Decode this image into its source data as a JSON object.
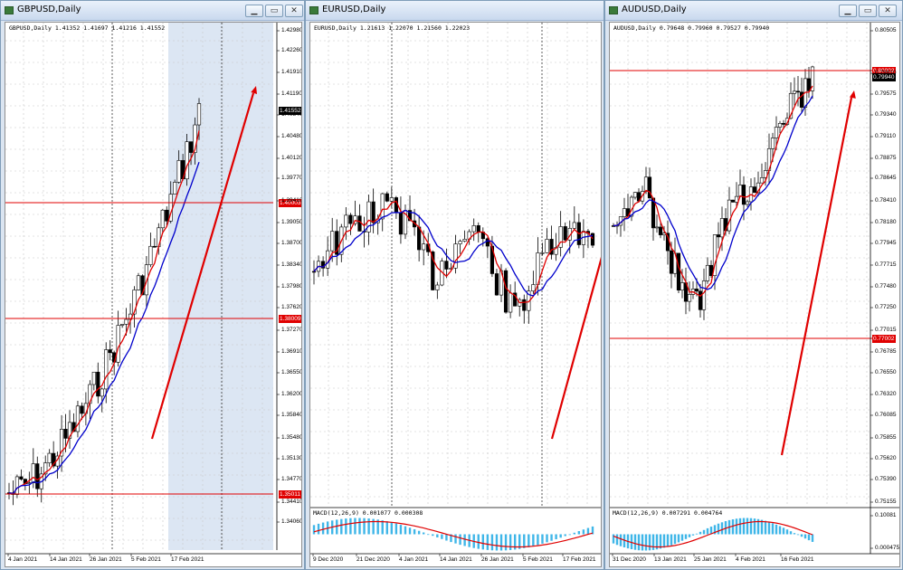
{
  "windows": [
    {
      "title": "GBPUSD,Daily",
      "header": "GBPUSD,Daily  1.41352 1.41697 1.41216 1.41552",
      "price_labels": [
        "1.42980",
        "1.42260",
        "1.41910",
        "1.41190",
        "1.40840",
        "1.40480",
        "1.40120",
        "1.39770",
        "1.39410",
        "1.39050",
        "1.38700",
        "1.38340",
        "1.37980",
        "1.37620",
        "1.37270",
        "1.36910",
        "1.36550",
        "1.36200",
        "1.35840",
        "1.35480",
        "1.35130",
        "1.34770",
        "1.34410",
        "1.34060"
      ],
      "current_price": "1.41552",
      "levels": [
        {
          "label": "1.40003"
        },
        {
          "label": "1.38009"
        },
        {
          "label": "1.35011"
        }
      ],
      "date_labels": [
        "4 Jan 2021",
        "14 Jan 2021",
        "26 Jan 2021",
        "5 Feb 2021",
        "17 Feb 2021"
      ],
      "macd_label": ""
    },
    {
      "title": "EURUSD,Daily",
      "header": "EURUSD,Daily  1.21613 1.22070 1.21560 1.22023",
      "price_labels": [],
      "current_price": "",
      "levels": [],
      "date_labels": [
        "9 Dec 2020",
        "21 Dec 2020",
        "4 Jan 2021",
        "14 Jan 2021",
        "26 Jan 2021",
        "5 Feb 2021",
        "17 Feb 2021"
      ],
      "macd_label": "MACD(12,26,9) 0.001077 0.000308"
    },
    {
      "title": "AUDUSD,Daily",
      "header": "AUDUSD,Daily  0.79648 0.79960 0.79527 0.79940",
      "price_labels": [
        "0.80505",
        "0.79810",
        "0.79575",
        "0.79340",
        "0.79110",
        "0.78875",
        "0.78645",
        "0.78410",
        "0.78180",
        "0.77945",
        "0.77715",
        "0.77480",
        "0.77250",
        "0.77015",
        "0.76785",
        "0.76550",
        "0.76320",
        "0.76085",
        "0.75855",
        "0.75620",
        "0.75390",
        "0.75155",
        "0.10081",
        "0.000475"
      ],
      "current_price": "0.79940",
      "levels": [
        {
          "label": "0.80002"
        },
        {
          "label": "0.77002"
        }
      ],
      "date_labels": [
        "31 Dec 2020",
        "13 Jan 2021",
        "25 Jan 2021",
        "4 Feb 2021",
        "16 Feb 2021"
      ],
      "macd_label": "MACD(12,26,9) 0.007291 0.004764"
    }
  ],
  "colors": {
    "level": "#e00000",
    "fast_ma": "#e00000",
    "slow_ma": "#0000cc",
    "arrow": "#e00000",
    "histogram": "#3fb6e8",
    "highlight": "#dce6f3"
  }
}
